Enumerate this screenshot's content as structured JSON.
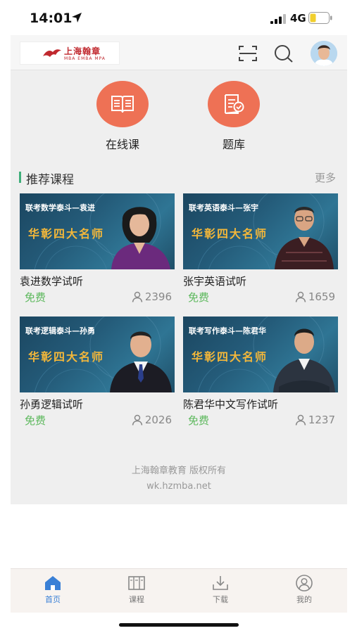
{
  "status": {
    "time": "14:01",
    "network": "4G"
  },
  "header": {
    "logo_title": "上海翰章",
    "logo_sub": "MBA EMBA MPA",
    "icons": [
      "scan-icon",
      "search-icon",
      "avatar"
    ]
  },
  "entries": [
    {
      "label": "在线课",
      "icon": "open-book-icon"
    },
    {
      "label": "题库",
      "icon": "exam-paper-icon"
    }
  ],
  "section": {
    "title": "推荐课程",
    "more": "更多"
  },
  "courses": [
    {
      "subtitle": "联考数学泰斗—袁进",
      "slogan": "华彰四大名师",
      "title": "袁进数学试听",
      "price": "免费",
      "views": "2396"
    },
    {
      "subtitle": "联考英语泰斗—张宇",
      "slogan": "华彰四大名师",
      "title": "张宇英语试听",
      "price": "免费",
      "views": "1659"
    },
    {
      "subtitle": "联考逻辑泰斗—孙勇",
      "slogan": "华彰四大名师",
      "title": "孙勇逻辑试听",
      "price": "免费",
      "views": "2026"
    },
    {
      "subtitle": "联考写作泰斗—陈君华",
      "slogan": "华彰四大名师",
      "title": "陈君华中文写作试听",
      "price": "免费",
      "views": "1237"
    }
  ],
  "footer": {
    "copyright": "上海翰章教育 版权所有",
    "site": "wk.hzmba.net"
  },
  "tabs": [
    {
      "label": "首页",
      "icon": "home-icon",
      "active": true
    },
    {
      "label": "课程",
      "icon": "course-icon",
      "active": false
    },
    {
      "label": "下载",
      "icon": "download-icon",
      "active": false
    },
    {
      "label": "我的",
      "icon": "profile-icon",
      "active": false
    }
  ],
  "colors": {
    "accent": "#3a80d6",
    "entry_circle": "#ee7155",
    "free": "#5cb85c",
    "section_bar": "#3fae7a",
    "slogan": "#f3b73a"
  }
}
